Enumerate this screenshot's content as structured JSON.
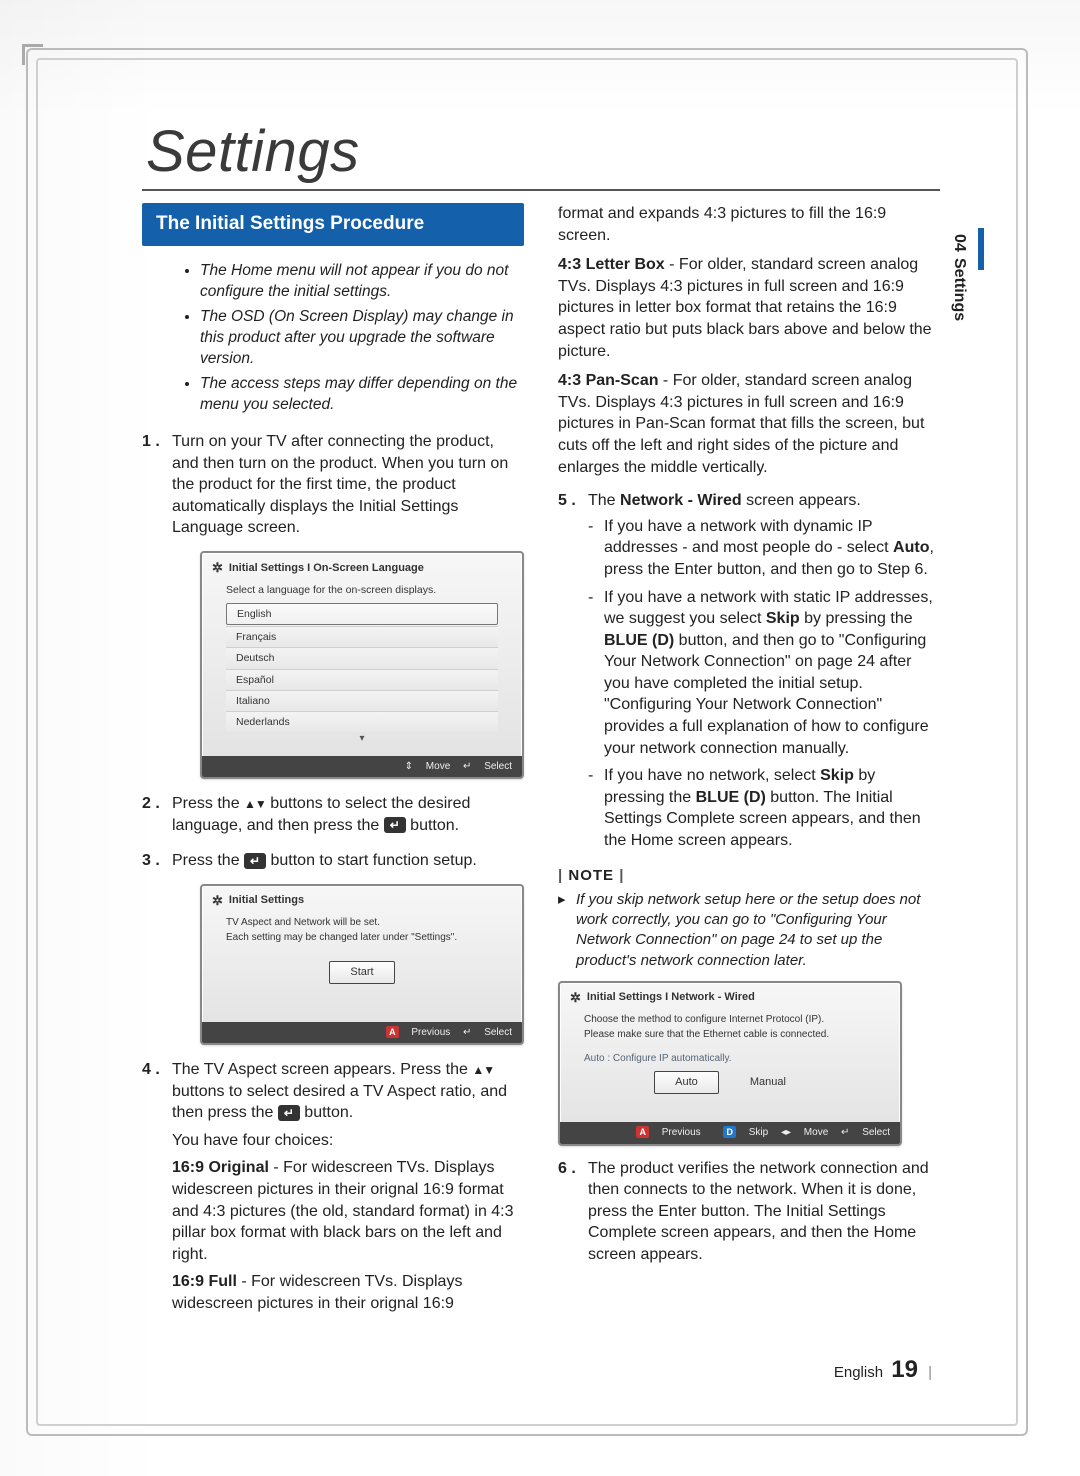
{
  "page": {
    "title": "Settings",
    "side_section_number": "04",
    "side_section_label": "Settings",
    "footer_lang": "English",
    "footer_page": "19"
  },
  "section_header": "The Initial Settings Procedure",
  "intro_notes": [
    "The Home menu will not appear if you do not configure the initial settings.",
    "The OSD (On Screen Display) may change in this product after you upgrade the software version.",
    "The access steps may differ depending on the menu you selected."
  ],
  "steps_left": {
    "s1": "Turn on your TV after connecting the product, and then turn on the product. When you turn on the product for the first time, the product automatically displays the Initial Settings Language screen.",
    "s2_a": "Press the ",
    "s2_b": " buttons to select the desired language, and then press the ",
    "s2_c": " button.",
    "s3_a": "Press the ",
    "s3_b": " button to start function setup.",
    "s4_a": "The TV Aspect screen appears. Press the ",
    "s4_b": " buttons to select desired a TV Aspect ratio, and then press the ",
    "s4_c": " button.",
    "s4_intro2": "You have four choices:",
    "s4_opt1_name": "16:9 Original",
    "s4_opt1_desc": " - For widescreen TVs. Displays widescreen pictures in their orignal 16:9 format and 4:3 pictures (the old, standard format) in 4:3 pillar box format with black bars on the left and right.",
    "s4_opt2_name": "16:9 Full",
    "s4_opt2_desc": " - For widescreen TVs. Displays widescreen pictures in their orignal 16:9"
  },
  "right_top": {
    "cont_16_9_full": "format and expands 4:3 pictures to fill the 16:9 screen.",
    "opt3_name": "4:3 Letter Box",
    "opt3_desc": " - For older, standard screen analog TVs. Displays 4:3 pictures in full screen and 16:9 pictures in letter box format that retains the 16:9 aspect ratio but puts black bars above and below the picture.",
    "opt4_name": "4:3 Pan-Scan",
    "opt4_desc": " - For older, standard screen analog TVs. Displays 4:3 pictures in full screen and 16:9 pictures in Pan-Scan format that fills the screen, but cuts off the left and right sides of the picture and enlarges the middle vertically."
  },
  "step5": {
    "intro_a": "The ",
    "intro_bold": "Network - Wired",
    "intro_b": " screen appears.",
    "d1_a": "If you have a network with dynamic IP addresses - and most people do - select ",
    "d1_bold": "Auto",
    "d1_b": ", press the Enter button, and then go to Step 6.",
    "d2_a": "If you have a network with static IP addresses, we suggest you select ",
    "d2_bold1": "Skip",
    "d2_b": " by pressing the ",
    "d2_bold2": "BLUE (D)",
    "d2_c": " button, and then go to \"Configuring Your Network Connection\" on page 24 after you have completed the initial setup. \"Configuring Your Network Connection\" provides a full explanation of how to configure your network connection manually.",
    "d3_a": "If you have no network, select ",
    "d3_bold1": "Skip",
    "d3_b": " by pressing the ",
    "d3_bold2": "BLUE (D)",
    "d3_c": " button. The Initial Settings Complete screen appears, and then the Home screen appears."
  },
  "note": {
    "label": "NOTE",
    "text": "If you skip network setup here or the setup does not work correctly, you can go to \"Configuring Your Network Connection\" on page 24 to set up the product's network connection later."
  },
  "step6": "The product verifies the network connection and then connects to the network. When it is done, press the Enter button. The Initial Settings Complete screen appears, and then the Home screen appears.",
  "shot_lang": {
    "title": "Initial Settings I On-Screen Language",
    "instr": "Select a language for the on-screen displays.",
    "opts": [
      "English",
      "Français",
      "Deutsch",
      "Español",
      "Italiano",
      "Nederlands"
    ],
    "footer_move": "Move",
    "footer_select": "Select"
  },
  "shot_aspect": {
    "title": "Initial Settings",
    "line1": "TV Aspect and Network will be set.",
    "line2": "Each setting may be changed later under \"Settings\".",
    "btn": "Start",
    "footer_prev": "Previous",
    "footer_select": "Select"
  },
  "shot_network": {
    "title": "Initial Settings I Network - Wired",
    "line1": "Choose the method to configure Internet Protocol (IP).",
    "line2": "Please make sure that the Ethernet cable is connected.",
    "autoline": "Auto : Configure IP automatically.",
    "btn_auto": "Auto",
    "btn_manual": "Manual",
    "footer_prev": "Previous",
    "footer_skip": "Skip",
    "footer_move": "Move",
    "footer_select": "Select"
  }
}
